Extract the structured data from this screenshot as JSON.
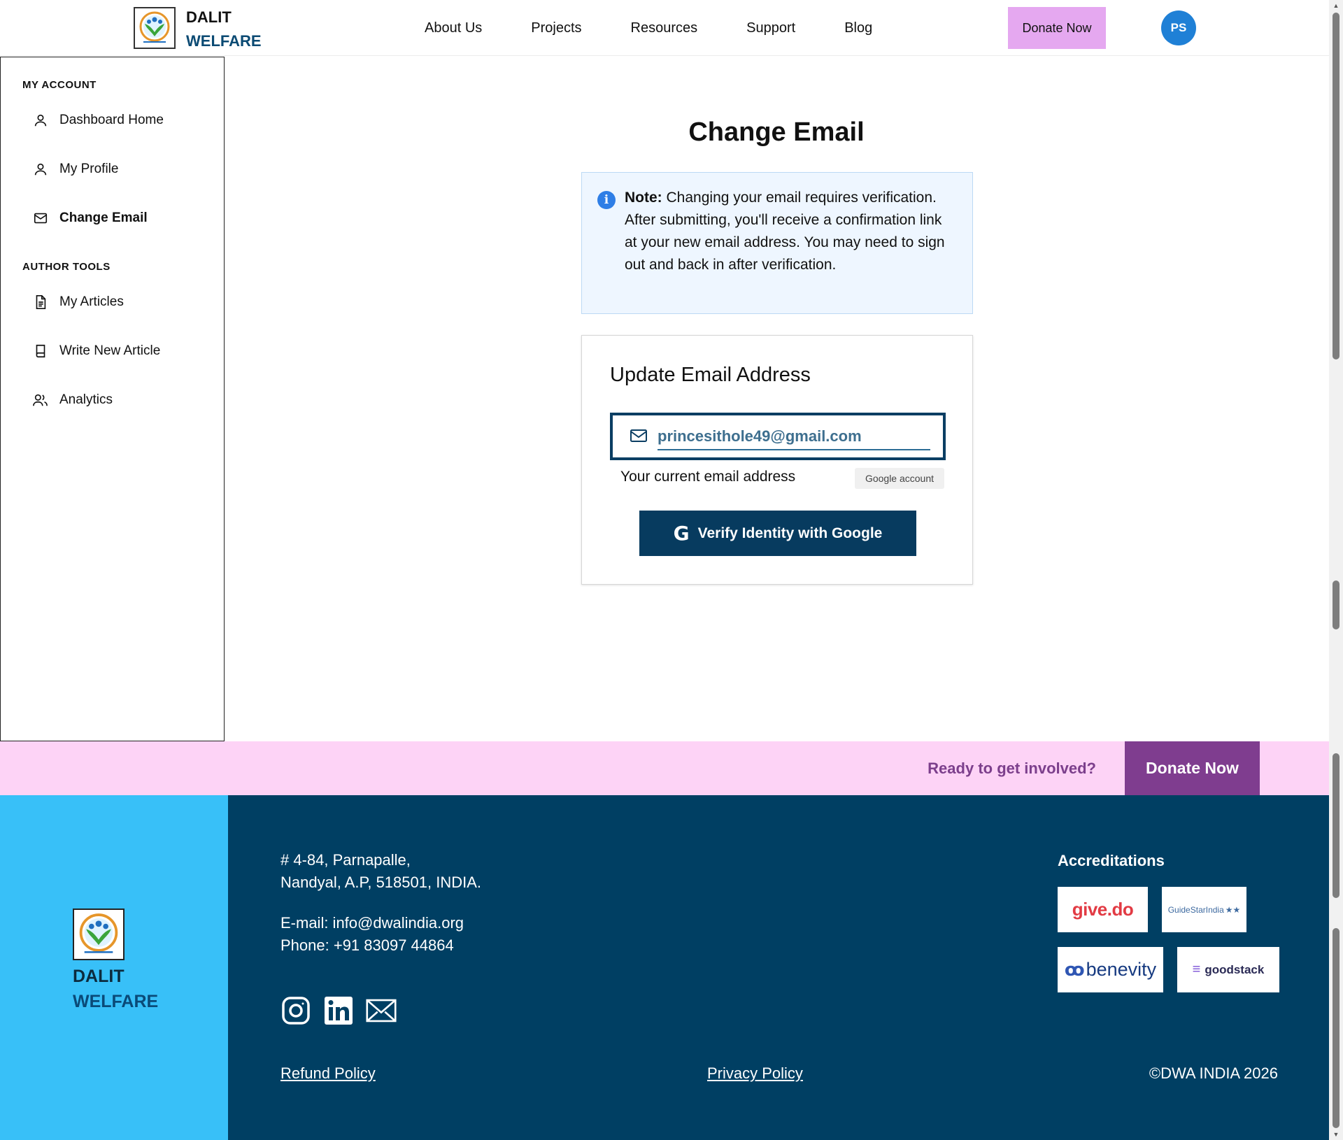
{
  "header": {
    "brand_line1": "DALIT",
    "brand_line2": "WELFARE",
    "nav": [
      "About Us",
      "Projects",
      "Resources",
      "Support",
      "Blog"
    ],
    "donate_label": "Donate Now",
    "avatar_initials": "PS"
  },
  "sidebar": {
    "section1_title": "MY ACCOUNT",
    "section1_items": [
      {
        "label": "Dashboard Home",
        "icon": "user-icon"
      },
      {
        "label": "My Profile",
        "icon": "user-icon"
      },
      {
        "label": "Change Email",
        "icon": "mail-icon",
        "active": true
      }
    ],
    "section2_title": "AUTHOR TOOLS",
    "section2_items": [
      {
        "label": "My Articles",
        "icon": "document-icon"
      },
      {
        "label": "Write New Article",
        "icon": "book-icon"
      },
      {
        "label": "Analytics",
        "icon": "users-icon"
      }
    ]
  },
  "main": {
    "title": "Change Email",
    "note_bold": "Note:",
    "note_text": "Changing your email requires verification. After submitting, you'll receive a confirmation link at your new email address. You may need to sign out and back in after verification.",
    "card_title": "Update Email Address",
    "email_value": "princesithole49@gmail.com",
    "current_label": "Your current email address",
    "google_badge": "Google account",
    "verify_label": "Verify Identity with Google"
  },
  "cta": {
    "text": "Ready to get involved?",
    "button": "Donate Now"
  },
  "footer": {
    "brand_line1": "DALIT",
    "brand_line2": "WELFARE",
    "address_line1": "# 4-84, Parnapalle,",
    "address_line2": "Nandyal, A.P, 518501, INDIA.",
    "email_line": "E-mail: info@dwalindia.org",
    "phone_line": "Phone: +91 83097 44864",
    "social": [
      "instagram-icon",
      "linkedin-icon",
      "mail-icon"
    ],
    "refund_policy": "Refund Policy",
    "privacy_policy": "Privacy Policy",
    "copyright": "©DWA INDIA 2026",
    "accreditations_title": "Accreditations",
    "accreditations": [
      "give.do",
      "GuideStarIndia",
      "benevity",
      "goodstack"
    ]
  },
  "colors": {
    "brand_dark": "#073b5f",
    "donate_pink": "#e5a8f0",
    "cta_bg": "#fdd3f6",
    "cta_purple": "#7f3d8f",
    "footer_bg": "#003f63",
    "footer_left": "#38c0f8",
    "avatar_blue": "#1f80d6"
  }
}
